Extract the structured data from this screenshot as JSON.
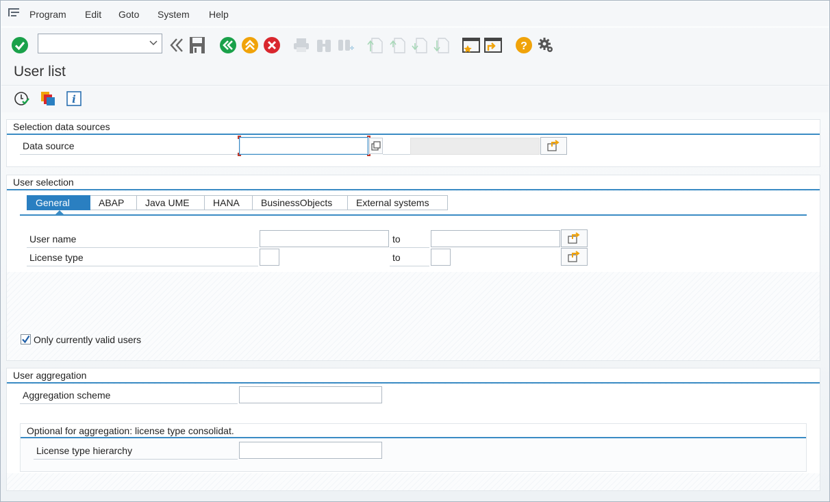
{
  "menu": {
    "items": [
      {
        "name": "program",
        "label": "Program"
      },
      {
        "name": "edit",
        "label": "Edit"
      },
      {
        "name": "goto",
        "label": "Goto"
      },
      {
        "name": "system",
        "label": "System"
      },
      {
        "name": "help",
        "label": "Help"
      }
    ]
  },
  "toolbar": {
    "command_field_value": "",
    "icons": [
      "enter-icon",
      "command-field",
      "collapse-icon",
      "save-icon",
      "back-icon",
      "exit-icon",
      "cancel-icon",
      "print-icon",
      "find-icon",
      "find-next-icon",
      "first-page-icon",
      "previous-page-icon",
      "next-page-icon",
      "last-page-icon",
      "new-session-icon",
      "shortcut-icon",
      "help-icon",
      "settings-icon"
    ]
  },
  "page": {
    "title": "User list"
  },
  "app_toolbar": {
    "icons": [
      "execute-icon",
      "get-variant-icon",
      "info-icon"
    ]
  },
  "selection_data_sources": {
    "title": "Selection data sources",
    "data_source_label": "Data source",
    "data_source_value": "",
    "data_source_desc": ""
  },
  "user_selection": {
    "title": "User selection",
    "tabs": [
      "General",
      "ABAP",
      "Java UME",
      "HANA",
      "BusinessObjects",
      "External systems"
    ],
    "active_tab": "General",
    "user_name_label": "User name",
    "user_name_from": "",
    "user_name_to": "",
    "license_type_label": "License type",
    "license_type_from": "",
    "license_type_to": "",
    "to_label": "to",
    "only_valid_label": "Only currently valid users",
    "only_valid_checked": true
  },
  "user_aggregation": {
    "title": "User aggregation",
    "aggregation_scheme_label": "Aggregation scheme",
    "aggregation_scheme_value": "",
    "optional_title": "Optional for aggregation: license type consolidat.",
    "license_hierarchy_label": "License type hierarchy",
    "license_hierarchy_value": ""
  },
  "colors": {
    "accent": "#3a8bc4",
    "active_tab": "#2a7fc1",
    "ok_green": "#1aa14a",
    "warn_orange": "#f0a30a",
    "cancel_red": "#d9272e"
  }
}
